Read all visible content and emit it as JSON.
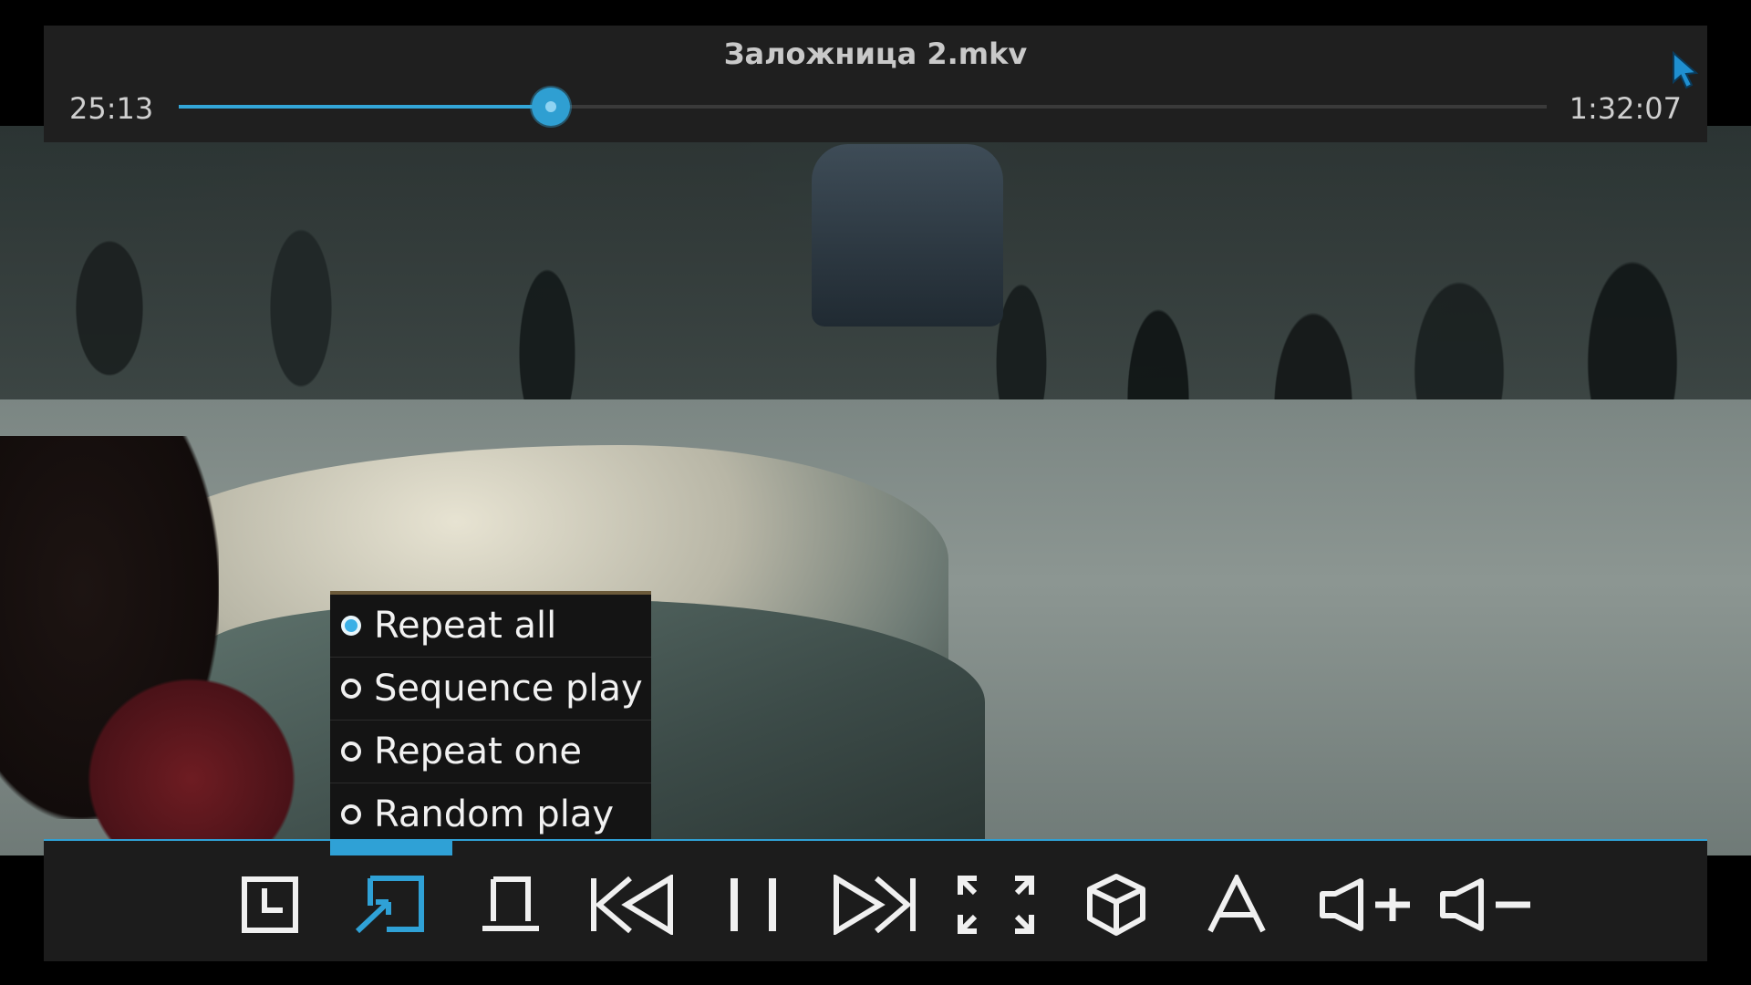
{
  "player": {
    "title": "Заложница 2.mkv",
    "elapsed": "25:13",
    "total": "1:32:07",
    "progress": 0.272
  },
  "repeat_menu": {
    "items": [
      {
        "label": "Repeat all",
        "selected": true
      },
      {
        "label": "Sequence play",
        "selected": false
      },
      {
        "label": "Repeat one",
        "selected": false
      },
      {
        "label": "Random play",
        "selected": false
      }
    ]
  },
  "controls": [
    {
      "name": "clock-icon"
    },
    {
      "name": "repeat-mode-icon",
      "active": true
    },
    {
      "name": "mode-icon"
    },
    {
      "name": "previous-icon"
    },
    {
      "name": "pause-icon"
    },
    {
      "name": "next-icon"
    },
    {
      "name": "fullscreen-icon"
    },
    {
      "name": "3d-icon"
    },
    {
      "name": "subtitle-icon"
    },
    {
      "name": "volume-up-icon"
    },
    {
      "name": "volume-down-icon"
    }
  ],
  "colors": {
    "accent": "#2fa1d6",
    "bar_background": "#1f1f1f",
    "icon": "#f0f0f0"
  }
}
